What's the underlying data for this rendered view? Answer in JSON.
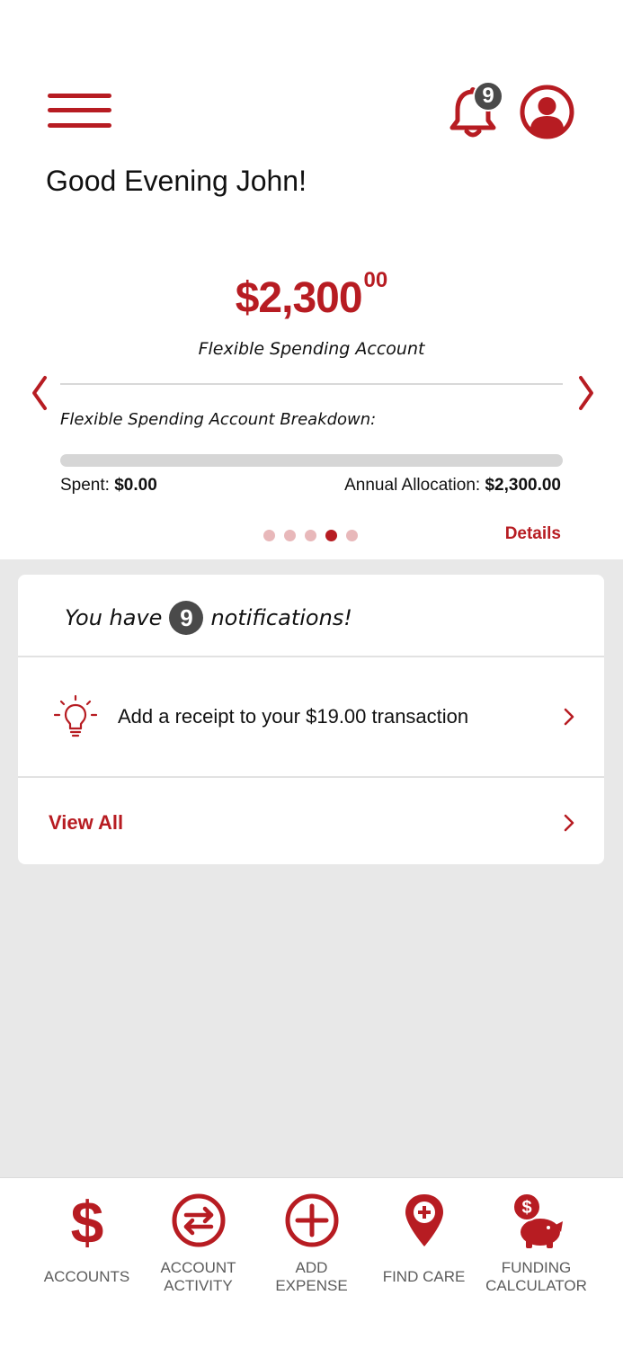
{
  "colors": {
    "brand": "#b71c22",
    "badge": "#4a4a4a",
    "background": "#e8e8e8"
  },
  "header": {
    "menu_icon": "hamburger-menu-icon",
    "bell_icon": "bell-icon",
    "notification_count": "9",
    "profile_icon": "user-avatar-icon",
    "greeting": "Good Evening John!"
  },
  "account_card": {
    "balance_main": "$2,300",
    "balance_cents": "00",
    "account_name": "Flexible Spending Account",
    "breakdown_title": "Flexible Spending Account Breakdown:",
    "spent_label": "Spent: ",
    "spent_value": "$0.00",
    "allocation_label": "Annual Allocation: ",
    "allocation_value": "$2,300.00",
    "progress_fraction": 0.0,
    "details_label": "Details",
    "pages": 5,
    "active_page": 4
  },
  "notifications": {
    "prefix": "You have",
    "count": "9",
    "suffix": "notifications!",
    "items": [
      {
        "icon": "lightbulb-icon",
        "text": "Add a receipt to your $19.00 transaction"
      }
    ],
    "view_all_label": "View All"
  },
  "bottom_nav": {
    "items": [
      {
        "icon": "dollar-icon",
        "line1": "ACCOUNTS",
        "line2": ""
      },
      {
        "icon": "exchange-arrows-icon",
        "line1": "ACCOUNT",
        "line2": "ACTIVITY"
      },
      {
        "icon": "plus-circle-icon",
        "line1": "ADD",
        "line2": "EXPENSE"
      },
      {
        "icon": "map-pin-plus-icon",
        "line1": "FIND CARE",
        "line2": ""
      },
      {
        "icon": "piggy-bank-icon",
        "line1": "FUNDING",
        "line2": "CALCULATOR"
      }
    ]
  }
}
